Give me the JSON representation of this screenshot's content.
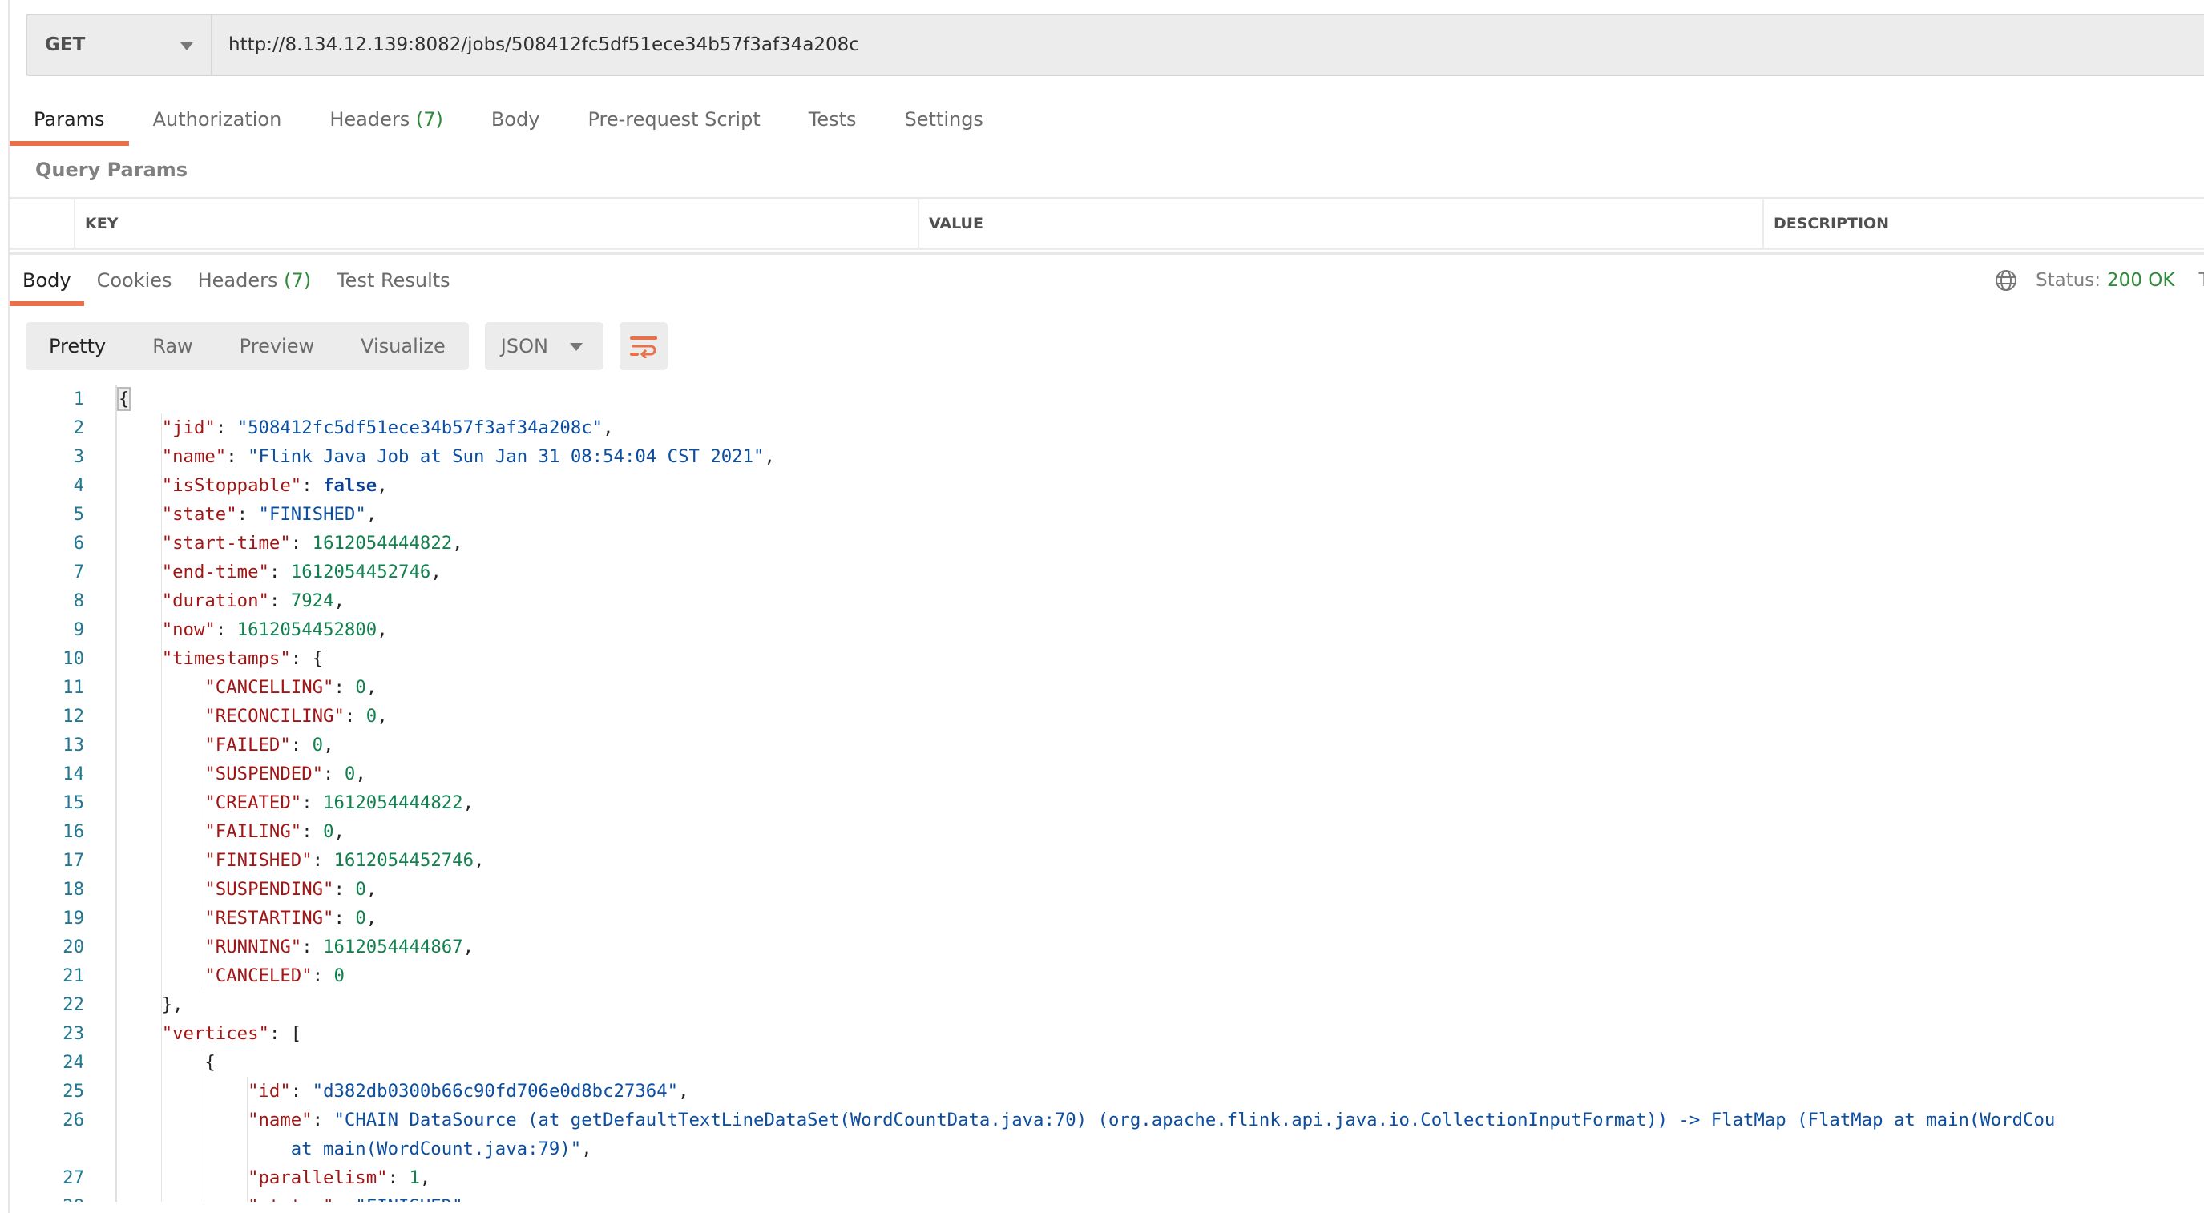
{
  "request": {
    "method": "GET",
    "url": "http://8.134.12.139:8082/jobs/508412fc5df51ece34b57f3af34a208c"
  },
  "request_tabs": [
    {
      "label": "Params",
      "active": true
    },
    {
      "label": "Authorization"
    },
    {
      "label": "Headers",
      "count": "(7)"
    },
    {
      "label": "Body"
    },
    {
      "label": "Pre-request Script"
    },
    {
      "label": "Tests"
    },
    {
      "label": "Settings"
    }
  ],
  "query_params": {
    "title": "Query Params",
    "columns": [
      "KEY",
      "VALUE",
      "DESCRIPTION"
    ]
  },
  "response_tabs": [
    {
      "label": "Body",
      "active": true
    },
    {
      "label": "Cookies"
    },
    {
      "label": "Headers",
      "count": "(7)"
    },
    {
      "label": "Test Results"
    }
  ],
  "response_status": {
    "icon": "globe-icon",
    "label": "Status:",
    "value": "200 OK",
    "next_label_partial": "Ti"
  },
  "format_toolbar": {
    "modes": [
      "Pretty",
      "Raw",
      "Preview",
      "Visualize"
    ],
    "active_mode": "Pretty",
    "language": "JSON",
    "wrap_icon": "wrap-lines-icon"
  },
  "colors": {
    "accent": "#e8704a",
    "status_ok": "#2e8b3a",
    "json_key": "#a31515",
    "json_string": "#0b4ea2",
    "json_number": "#12814f"
  },
  "code": [
    {
      "n": 1,
      "indent": 0,
      "text": "{"
    },
    {
      "n": 2,
      "indent": 1,
      "text": "\"jid\": \"508412fc5df51ece34b57f3af34a208c\","
    },
    {
      "n": 3,
      "indent": 1,
      "text": "\"name\": \"Flink Java Job at Sun Jan 31 08:54:04 CST 2021\","
    },
    {
      "n": 4,
      "indent": 1,
      "text": "\"isStoppable\": false,"
    },
    {
      "n": 5,
      "indent": 1,
      "text": "\"state\": \"FINISHED\","
    },
    {
      "n": 6,
      "indent": 1,
      "text": "\"start-time\": 1612054444822,"
    },
    {
      "n": 7,
      "indent": 1,
      "text": "\"end-time\": 1612054452746,"
    },
    {
      "n": 8,
      "indent": 1,
      "text": "\"duration\": 7924,"
    },
    {
      "n": 9,
      "indent": 1,
      "text": "\"now\": 1612054452800,"
    },
    {
      "n": 10,
      "indent": 1,
      "text": "\"timestamps\": {"
    },
    {
      "n": 11,
      "indent": 2,
      "text": "\"CANCELLING\": 0,"
    },
    {
      "n": 12,
      "indent": 2,
      "text": "\"RECONCILING\": 0,"
    },
    {
      "n": 13,
      "indent": 2,
      "text": "\"FAILED\": 0,"
    },
    {
      "n": 14,
      "indent": 2,
      "text": "\"SUSPENDED\": 0,"
    },
    {
      "n": 15,
      "indent": 2,
      "text": "\"CREATED\": 1612054444822,"
    },
    {
      "n": 16,
      "indent": 2,
      "text": "\"FAILING\": 0,"
    },
    {
      "n": 17,
      "indent": 2,
      "text": "\"FINISHED\": 1612054452746,"
    },
    {
      "n": 18,
      "indent": 2,
      "text": "\"SUSPENDING\": 0,"
    },
    {
      "n": 19,
      "indent": 2,
      "text": "\"RESTARTING\": 0,"
    },
    {
      "n": 20,
      "indent": 2,
      "text": "\"RUNNING\": 1612054444867,"
    },
    {
      "n": 21,
      "indent": 2,
      "text": "\"CANCELED\": 0"
    },
    {
      "n": 22,
      "indent": 1,
      "text": "},"
    },
    {
      "n": 23,
      "indent": 1,
      "text": "\"vertices\": ["
    },
    {
      "n": 24,
      "indent": 2,
      "text": "{"
    },
    {
      "n": 25,
      "indent": 3,
      "text": "\"id\": \"d382db0300b66c90fd706e0d8bc27364\","
    },
    {
      "n": 26,
      "indent": 3,
      "text": "\"name\": \"CHAIN DataSource (at getDefaultTextLineDataSet(WordCountData.java:70) (org.apache.flink.api.java.io.CollectionInputFormat)) -> FlatMap (FlatMap at main(WordCou"
    },
    {
      "n": "",
      "indent": 3,
      "cont": "    at main(WordCount.java:79)\"",
      "tail": ","
    },
    {
      "n": 27,
      "indent": 3,
      "text": "\"parallelism\": 1,"
    },
    {
      "n": 28,
      "indent": 3,
      "text": "\"status\": \"FINISHED\","
    }
  ]
}
